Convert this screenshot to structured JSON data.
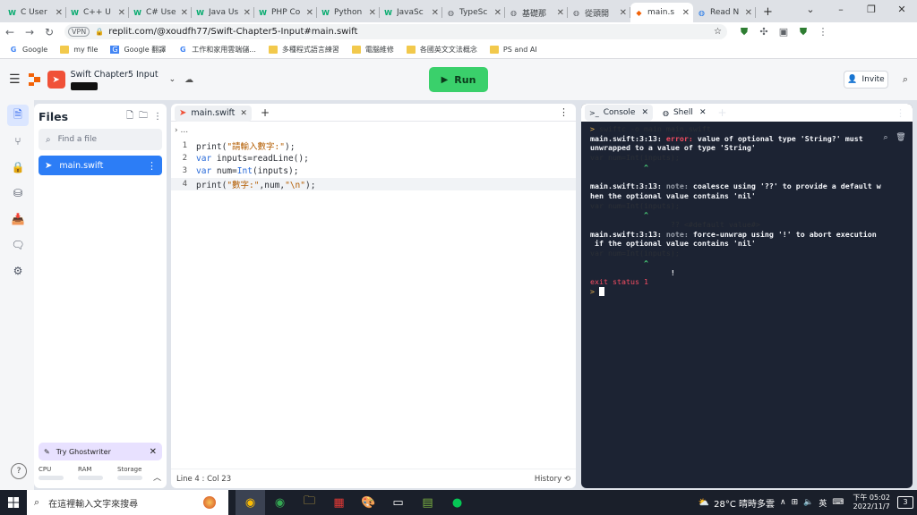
{
  "browser": {
    "tabs": [
      {
        "label": "C User",
        "favicon": "W",
        "color": "#04aa6d"
      },
      {
        "label": "C++ U",
        "favicon": "W",
        "color": "#04aa6d"
      },
      {
        "label": "C# Use",
        "favicon": "W",
        "color": "#04aa6d"
      },
      {
        "label": "Java Us",
        "favicon": "W",
        "color": "#04aa6d"
      },
      {
        "label": "PHP Co",
        "favicon": "W",
        "color": "#04aa6d"
      },
      {
        "label": "Python",
        "favicon": "W",
        "color": "#04aa6d"
      },
      {
        "label": "JavaSc",
        "favicon": "W",
        "color": "#04aa6d"
      },
      {
        "label": "TypeSc",
        "favicon": "globe-icon",
        "color": "#5f6368"
      },
      {
        "label": "基礎那",
        "favicon": "globe-icon",
        "color": "#5f6368"
      },
      {
        "label": "從頭開",
        "favicon": "globe-icon",
        "color": "#5f6368"
      },
      {
        "label": "main.s",
        "favicon": "replit-icon",
        "color": "#f26207"
      },
      {
        "label": "Read N",
        "favicon": "globe-icon",
        "color": "#1a73e8"
      }
    ],
    "new_tab": "+",
    "url": "replit.com/@xoudfh77/Swift-Chapter5-Input#main.swift",
    "vpn": "VPN",
    "bookmarks": [
      {
        "label": "Google",
        "icon": "google-icon"
      },
      {
        "label": "my file",
        "icon": "folder-icon"
      },
      {
        "label": "Google 翻譯",
        "icon": "translate-icon"
      },
      {
        "label": "工作和家用雲端儲...",
        "icon": "google-icon"
      },
      {
        "label": "多種程式語言練習",
        "icon": "folder-icon"
      },
      {
        "label": "電腦維修",
        "icon": "folder-icon"
      },
      {
        "label": "各國英文文法概念",
        "icon": "folder-icon"
      },
      {
        "label": "PS and AI",
        "icon": "folder-icon"
      }
    ]
  },
  "replit": {
    "project_name": "Swift Chapter5 Input",
    "run_label": "Run",
    "invite_label": "Invite",
    "files_title": "Files",
    "find_placeholder": "Find a file",
    "file_name": "main.swift",
    "ghostwriter_label": "Try Ghostwriter",
    "resources": [
      "CPU",
      "RAM",
      "Storage"
    ],
    "editor_tab": "main.swift",
    "breadcrumb": "...",
    "status": "Line 4 : Col 23",
    "history": "History",
    "code": [
      {
        "n": "1",
        "parts": [
          [
            "pl",
            "print("
          ],
          [
            "s",
            "\"請輸入數字:\""
          ],
          [
            "pl",
            ");"
          ]
        ]
      },
      {
        "n": "2",
        "parts": [
          [
            "k",
            "var"
          ],
          [
            "pl",
            " inputs=readLine();"
          ]
        ]
      },
      {
        "n": "3",
        "parts": [
          [
            "k",
            "var"
          ],
          [
            "pl",
            " num="
          ],
          [
            "k",
            "Int"
          ],
          [
            "pl",
            "(inputs);"
          ]
        ]
      },
      {
        "n": "4",
        "parts": [
          [
            "pl",
            "print("
          ],
          [
            "s",
            "\"數字:\""
          ],
          [
            "pl",
            ",num,"
          ],
          [
            "s",
            "\"\\n\""
          ],
          [
            "pl",
            ");"
          ]
        ]
      }
    ],
    "console_tab": "Console",
    "shell_tab": "Shell",
    "console_lines": [
      [
        [
          "prompt",
          "> "
        ],
        [
          "pl",
          "swiftc -o main main.swift"
        ]
      ],
      [
        [
          "b",
          "main.swift:3:13: "
        ],
        [
          "err",
          "error: "
        ],
        [
          "b",
          "value of optional type 'String?' must"
        ]
      ],
      [
        [
          "b",
          "unwrapped to a value of type 'String'"
        ]
      ],
      [
        [
          "pl",
          "var num=Int(inputs);"
        ]
      ],
      [
        [
          "car",
          "            ^"
        ]
      ],
      [
        [
          "pl",
          ""
        ]
      ],
      [
        [
          "b",
          "main.swift:3:13: "
        ],
        [
          "note",
          "note: "
        ],
        [
          "b",
          "coalesce using '??' to provide a default w"
        ]
      ],
      [
        [
          "b",
          "hen the optional value contains 'nil'"
        ]
      ],
      [
        [
          "pl",
          "var num=Int(inputs);"
        ]
      ],
      [
        [
          "car",
          "            ^"
        ]
      ],
      [
        [
          "pl",
          "                  ?? <#default value#>"
        ]
      ],
      [
        [
          "b",
          "main.swift:3:13: "
        ],
        [
          "note",
          "note: "
        ],
        [
          "b",
          "force-unwrap using '!' to abort execution"
        ]
      ],
      [
        [
          "b",
          " if the optional value contains 'nil'"
        ]
      ],
      [
        [
          "pl",
          "var num=Int(inputs);"
        ]
      ],
      [
        [
          "car",
          "            ^"
        ]
      ],
      [
        [
          "b",
          "                  !"
        ]
      ],
      [
        [
          "exit",
          "exit status 1"
        ]
      ]
    ],
    "final_prompt": "> "
  },
  "taskbar": {
    "search_placeholder": "在這裡輸入文字來搜尋",
    "weather": "28°C  晴時多雲",
    "ime": "英",
    "time": "下午 05:02",
    "date": "2022/11/7",
    "notifications": "3"
  }
}
